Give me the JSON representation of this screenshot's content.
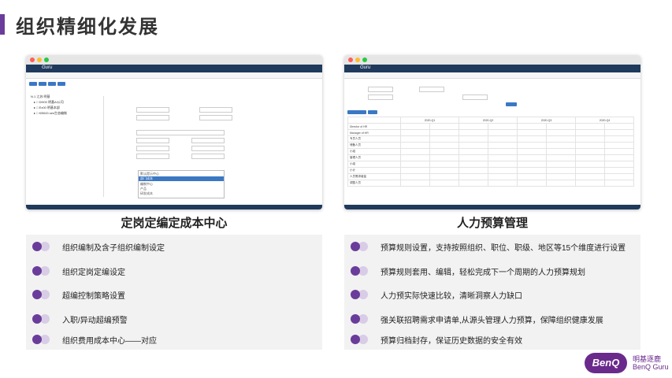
{
  "page": {
    "title": "组织精细化发展"
  },
  "left_panel": {
    "caption": "定岗定编定成本中心",
    "app_name": "Guru",
    "tree": [
      "N.1 江苏 明基",
      "▸ □ DH00 明基AI公司",
      "▸ □ Ex00 明基本部",
      "▸ □ KB043 ses生态编制"
    ],
    "dropdown_options": [
      "默认提示中心",
      "部门成本",
      "编制中心",
      "产品",
      "研发成本"
    ],
    "items": [
      "组织编制及含子组织编制设定",
      "组织定岗定编设定",
      "超编控制策略设置",
      "入职/异动超编预警",
      "组织费用成本中心——对应"
    ]
  },
  "right_panel": {
    "caption": "人力预算管理",
    "app_name": "Guru",
    "quarters": [
      "2020-Q1",
      "2020-Q2",
      "2020-Q3",
      "2020-Q4"
    ],
    "row_labels": [
      "Director of HR",
      "Manager of HR",
      "专员人员",
      "储备人员",
      "小组",
      "管理人员",
      "小组",
      "小计",
      "人员需求增量",
      "调整人员"
    ],
    "items": [
      "预算规则设置，支持按照组织、职位、职级、地区等15个维度进行设置",
      "预算规则套用、编辑，轻松完成下一个周期的人力预算规划",
      "人力预实际快速比较，清晰洞察人力缺口",
      "强关联招聘需求申请单,从源头管理人力预算，保障组织健康发展",
      "预算归档封存，保证历史数据的安全有效"
    ]
  },
  "brand": {
    "mark": "BenQ",
    "cn": "明基逐鹿",
    "en": "BenQ Guru"
  },
  "colors": {
    "accent": "#6a3d9a",
    "nav": "#1f3a5c"
  }
}
